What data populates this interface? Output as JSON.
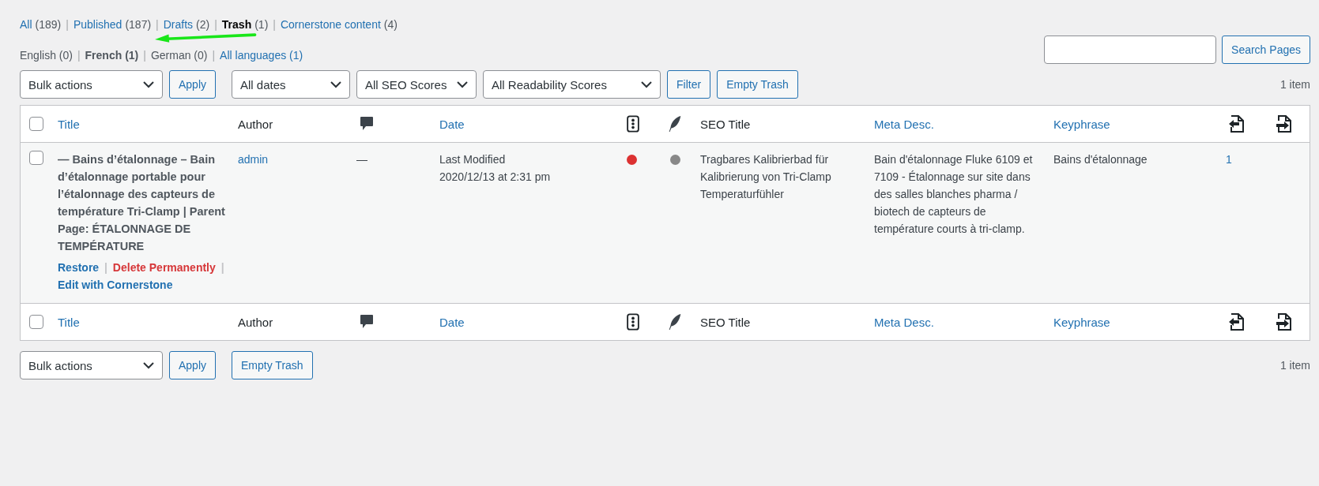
{
  "status_links": [
    {
      "label": "All",
      "count": "(189)",
      "selected": false,
      "separator": "|"
    },
    {
      "label": "Published",
      "count": "(187)",
      "selected": false,
      "separator": "|"
    },
    {
      "label": "Drafts",
      "count": "(2)",
      "selected": false,
      "separator": "|"
    },
    {
      "label": "Trash",
      "count": "(1)",
      "selected": true,
      "separator": "|"
    },
    {
      "label": "Cornerstone content",
      "count": "(4)",
      "selected": false
    }
  ],
  "language_links": [
    {
      "label": "English (0)",
      "kind": "text",
      "selected": false,
      "separator": "|"
    },
    {
      "label": "French (1)",
      "kind": "text",
      "selected": true,
      "separator": "|"
    },
    {
      "label": "German (0)",
      "kind": "text",
      "selected": false,
      "separator": "|"
    },
    {
      "label": "All languages (1)",
      "kind": "link",
      "selected": false
    }
  ],
  "search": {
    "button": "Search Pages"
  },
  "top_nav": {
    "bulk_action": "Bulk actions",
    "apply": "Apply",
    "filters": [
      "All dates",
      "All SEO Scores",
      "All Readability Scores"
    ],
    "filter_button": "Filter",
    "empty_trash": "Empty Trash",
    "count": "1 item"
  },
  "columns": [
    {
      "kind": "checkbox",
      "checked": false
    },
    {
      "kind": "text",
      "label": "Title",
      "sortable": true
    },
    {
      "kind": "text",
      "label": "Author",
      "sortable": false
    },
    {
      "kind": "comments"
    },
    {
      "kind": "text",
      "label": "Date",
      "sortable": true
    },
    {
      "kind": "seo"
    },
    {
      "kind": "readability"
    },
    {
      "kind": "text",
      "label": "SEO Title",
      "sortable": false
    },
    {
      "kind": "text",
      "label": "Meta Desc.",
      "sortable": true
    },
    {
      "kind": "text",
      "label": "Keyphrase",
      "sortable": true
    },
    {
      "kind": "links"
    },
    {
      "kind": "linked"
    }
  ],
  "rows": [
    {
      "checked": false,
      "title": "— Bains d’étalonnage – Bain d’étalonnage portable pour l’étalonnage des capteurs de température Tri-Clamp | Parent Page: ÉTALONNAGE DE TEMPÉRATURE",
      "actions": [
        {
          "label": "Restore",
          "danger": false,
          "separator": "|"
        },
        {
          "label": "Delete Permanently",
          "danger": true,
          "separator": "|"
        },
        {
          "label": "Edit with Cornerstone",
          "danger": false
        }
      ],
      "author": "admin",
      "comments": "—",
      "date_status": "Last Modified",
      "date": "2020/12/13 at 2:31 pm",
      "seo_score": {
        "color": "#dc3232"
      },
      "readability_score": {
        "color": "#888888"
      },
      "seo_title": "Tragbares Kalibrierbad für Kalibrierung von Tri-Clamp Temperaturfühler",
      "meta_desc": "Bain d'étalonnage Fluke 6109 et 7109 - Étalonnage sur site dans des salles blanches pharma / biotech de capteurs de température courts à tri-clamp.",
      "keyphrase": "Bains d'étalonnage",
      "links": "1"
    }
  ],
  "footer_columns": [
    {
      "kind": "checkbox",
      "checked": false
    },
    {
      "kind": "text",
      "label": "Title",
      "sortable": true
    },
    {
      "kind": "text",
      "label": "Author",
      "sortable": false
    },
    {
      "kind": "comments"
    },
    {
      "kind": "text",
      "label": "Date",
      "sortable": true
    },
    {
      "kind": "seo"
    },
    {
      "kind": "readability"
    },
    {
      "kind": "text",
      "label": "SEO Title",
      "sortable": false
    },
    {
      "kind": "text",
      "label": "Meta Desc.",
      "sortable": true
    },
    {
      "kind": "text",
      "label": "Keyphrase",
      "sortable": true
    },
    {
      "kind": "links"
    },
    {
      "kind": "linked"
    }
  ],
  "bottom_nav": {
    "bulk_action": "Bulk actions",
    "apply": "Apply",
    "empty_trash": "Empty Trash",
    "count": "1 item"
  }
}
